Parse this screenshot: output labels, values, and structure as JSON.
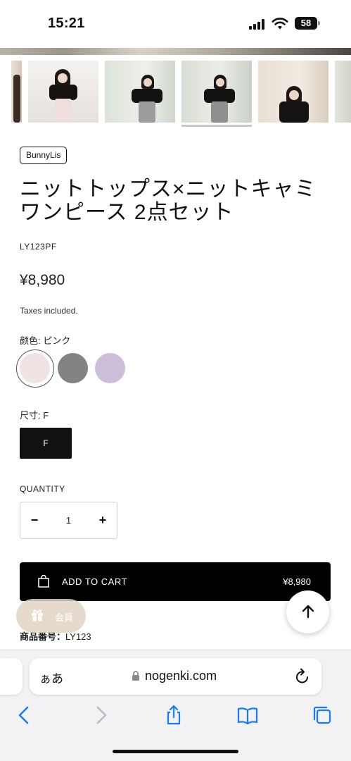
{
  "status_bar": {
    "time": "15:21",
    "battery": "58"
  },
  "product": {
    "vendor": "BunnyLis",
    "title": "ニットトップス×ニットキャミワンピース 2点セット",
    "sku": "LY123PF",
    "price": "¥8,980",
    "taxes_note": "Taxes included.",
    "color_label": "颜色: ピンク",
    "colors": [
      {
        "name": "pink",
        "hex": "#f1e3e4",
        "selected": true
      },
      {
        "name": "gray",
        "hex": "#838383",
        "selected": false
      },
      {
        "name": "lavender",
        "hex": "#cdbfdb",
        "selected": false
      }
    ],
    "size_label": "尺寸: F",
    "size_options": [
      "F"
    ],
    "quantity_label": "QUANTITY",
    "quantity": "1",
    "decrease_symbol": "−",
    "increase_symbol": "+",
    "add_to_cart_label": "ADD TO CART",
    "add_to_cart_price": "¥8,980",
    "product_number_label": "商品番号：",
    "product_number_value": "LY123"
  },
  "member_button": {
    "label": "会員",
    "icon": "gift-icon"
  },
  "browser": {
    "aa_label": "ぁあ",
    "url": "nogenki.com",
    "toolbar_icons": [
      "back-icon",
      "forward-icon",
      "share-icon",
      "bookmarks-icon",
      "tabs-icon"
    ]
  },
  "colors": {
    "accent": "#000000",
    "ios_blue": "#1a7cf5"
  }
}
